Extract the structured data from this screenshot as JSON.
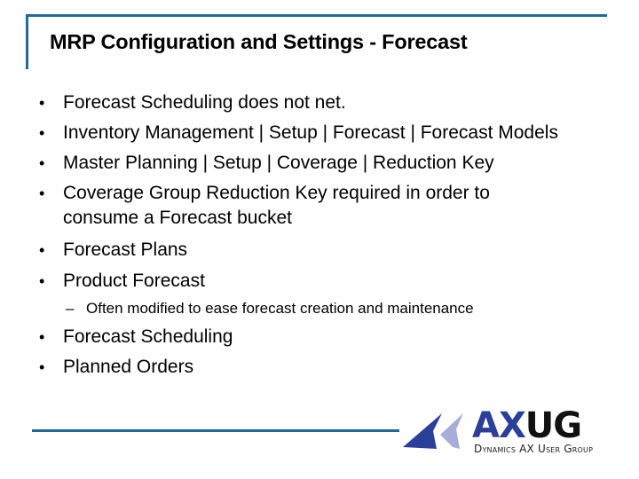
{
  "slide": {
    "title": "MRP Configuration and Settings - Forecast",
    "bullet_glyph": "•",
    "sub_bullet_glyph": "–",
    "bullets": [
      {
        "text": "Forecast Scheduling does not net."
      },
      {
        "text": "Inventory Management | Setup | Forecast | Forecast Models"
      },
      {
        "text": "Master Planning | Setup | Coverage | Reduction Key"
      },
      {
        "text": "Coverage Group Reduction Key required in order to",
        "continuation": "consume a Forecast bucket"
      },
      {
        "text": "Forecast Plans"
      },
      {
        "text": "Product Forecast",
        "sub_items": [
          "Often modified to ease forecast creation and maintenance"
        ]
      },
      {
        "text": "Forecast Scheduling"
      },
      {
        "text": "Planned Orders"
      }
    ]
  },
  "logo": {
    "word_ax": "AX",
    "word_ug": "UG",
    "tagline": "Dynamics AX User Group",
    "colors": {
      "primary": "#2a3f9a",
      "secondary": "#a8acd8",
      "dark": "#111111"
    }
  },
  "accent_color": "#1f6a9b"
}
